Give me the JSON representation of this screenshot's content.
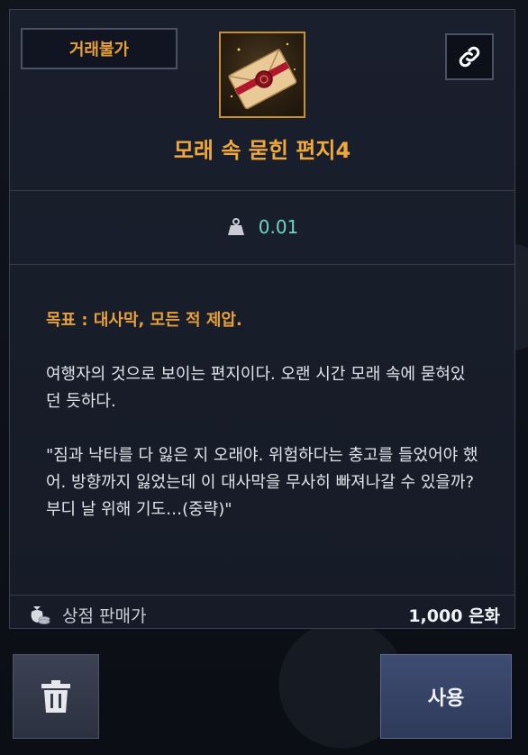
{
  "item": {
    "trade_tag": "거래불가",
    "title": "모래 속 묻힌 편지4",
    "icon": "sealed-letter-icon"
  },
  "weight": {
    "icon": "weight-icon",
    "value": "0.01"
  },
  "description": {
    "goal": "목표 : 대사막, 모든 적 제압.",
    "paragraph1": "여행자의 것으로 보이는 편지이다. 오랜 시간 모래 속에 묻혀있던 듯하다.",
    "paragraph2": "\"짐과 낙타를 다 잃은 지 오래야. 위험하다는 충고를 들었어야 했어. 방향까지 잃었는데 이 대사막을 무사히 빠져나갈 수 있을까? 부디 날 위해 기도…(중략)\""
  },
  "price": {
    "icon": "coin-bag-icon",
    "label": "상점 판매가",
    "value": "1,000 은화"
  },
  "buttons": {
    "delete_icon": "trash-icon",
    "use_label": "사용"
  },
  "colors": {
    "accent": "#e8a13a",
    "weight_value": "#6fd4c6",
    "panel": "#1a1f2d"
  }
}
